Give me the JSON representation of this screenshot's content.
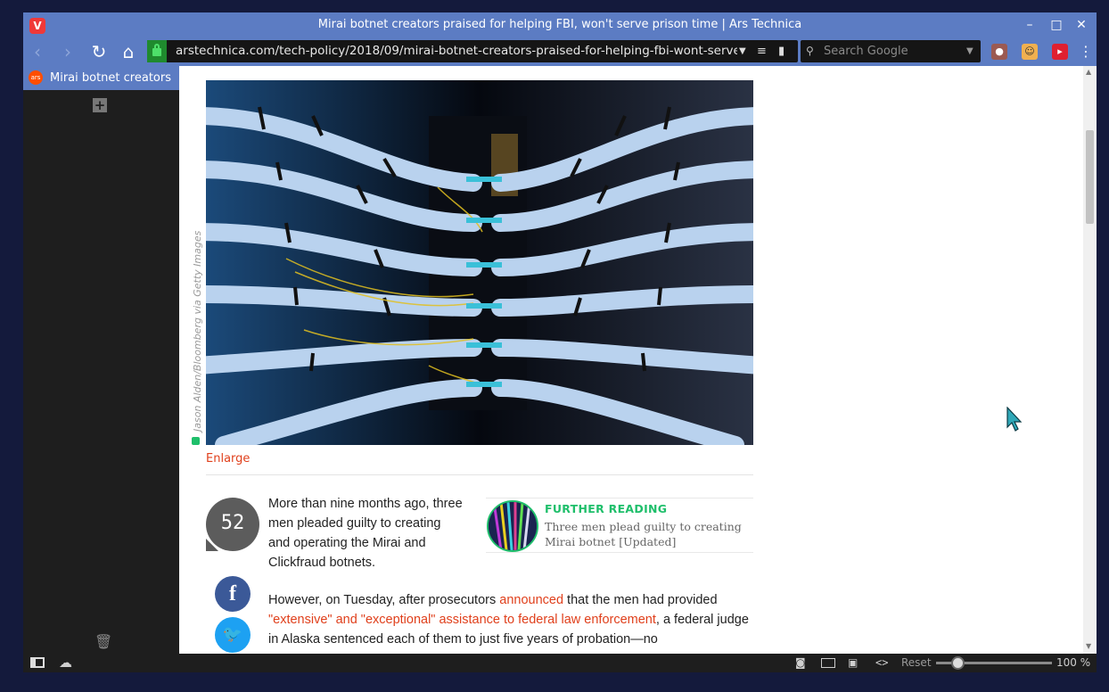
{
  "window": {
    "title": "Mirai botnet creators praised for helping FBI, won't serve prison time | Ars Technica",
    "logo": "V",
    "minimize": "–",
    "maximize": "□",
    "close": "✕"
  },
  "nav": {
    "back": "‹",
    "forward": "›",
    "reload": "↻",
    "home": "⌂",
    "url": "arstechnica.com/tech-policy/2018/09/mirai-botnet-creators-praised-for-helping-fbi-wont-serve...",
    "search_placeholder": "Search Google",
    "menu": "⋮"
  },
  "tabs": [
    {
      "label": "Mirai botnet creators praised for helping FBI",
      "favicon": "ars"
    }
  ],
  "panel": {
    "new_tab": "+",
    "trash": "🗑"
  },
  "article": {
    "photo_credit": "Jason Alden/Bloomberg via Getty Images",
    "enlarge": "Enlarge",
    "comment_count": "52",
    "facebook": "f",
    "twitter": "🐦",
    "intro": "More than nine months ago, three men pleaded guilty to creating and operating the Mirai and Clickfraud botnets.",
    "further_reading": {
      "label": "FURTHER READING",
      "title": "Three men plead guilty to creating Mirai botnet [Updated]"
    },
    "p2_a": "However, on Tuesday, after prosecutors ",
    "p2_link1": "announced",
    "p2_b": " that the men had provided ",
    "p2_link2": "\"extensive\" and \"exceptional\" assistance to federal law enforcement",
    "p2_c": ", a federal judge in Alaska sentenced each of them to just five years of probation—no"
  },
  "status": {
    "zoom_reset": "Reset",
    "zoom_level": "100 %",
    "zoom_fraction": 0.15
  },
  "colors": {
    "chrome": "#5c7cc3",
    "accent_link": "#e0401c",
    "further_reading": "#1fbf6b"
  }
}
